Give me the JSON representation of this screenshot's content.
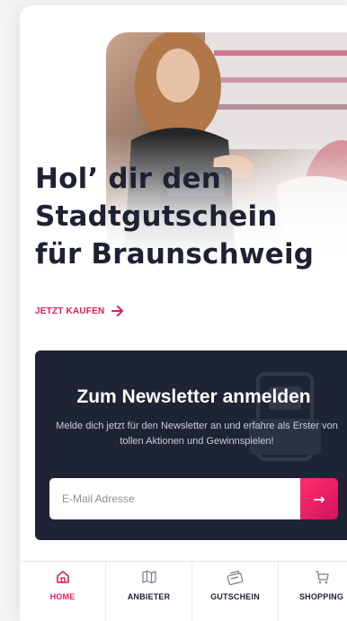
{
  "hero": {
    "title_lines": [
      "Hol’ dir den",
      "Stadtgutschein",
      "für Braunschweig"
    ],
    "cta_label": "JETZT KAUFEN",
    "cta_icon": "arrow-right-icon"
  },
  "newsletter": {
    "title": "Zum Newsletter anmelden",
    "text": "Melde dich jetzt für den Newsletter an und erfahre als Erster von tollen Aktionen und Gewinnspielen!",
    "email_placeholder": "E-Mail Adresse",
    "email_value": "",
    "submit_icon": "arrow-right-icon",
    "submit_glyph": "→"
  },
  "bottom_nav": {
    "items": [
      {
        "label": "HOME",
        "icon": "home-icon",
        "active": true
      },
      {
        "label": "ANBIETER",
        "icon": "map-icon",
        "active": false
      },
      {
        "label": "GUTSCHEIN",
        "icon": "voucher-icon",
        "active": false
      },
      {
        "label": "SHOPPING",
        "icon": "cart-icon",
        "active": false
      }
    ]
  },
  "colors": {
    "accent": "#e8195f",
    "dark": "#1f2434",
    "text": "#1d2233"
  }
}
